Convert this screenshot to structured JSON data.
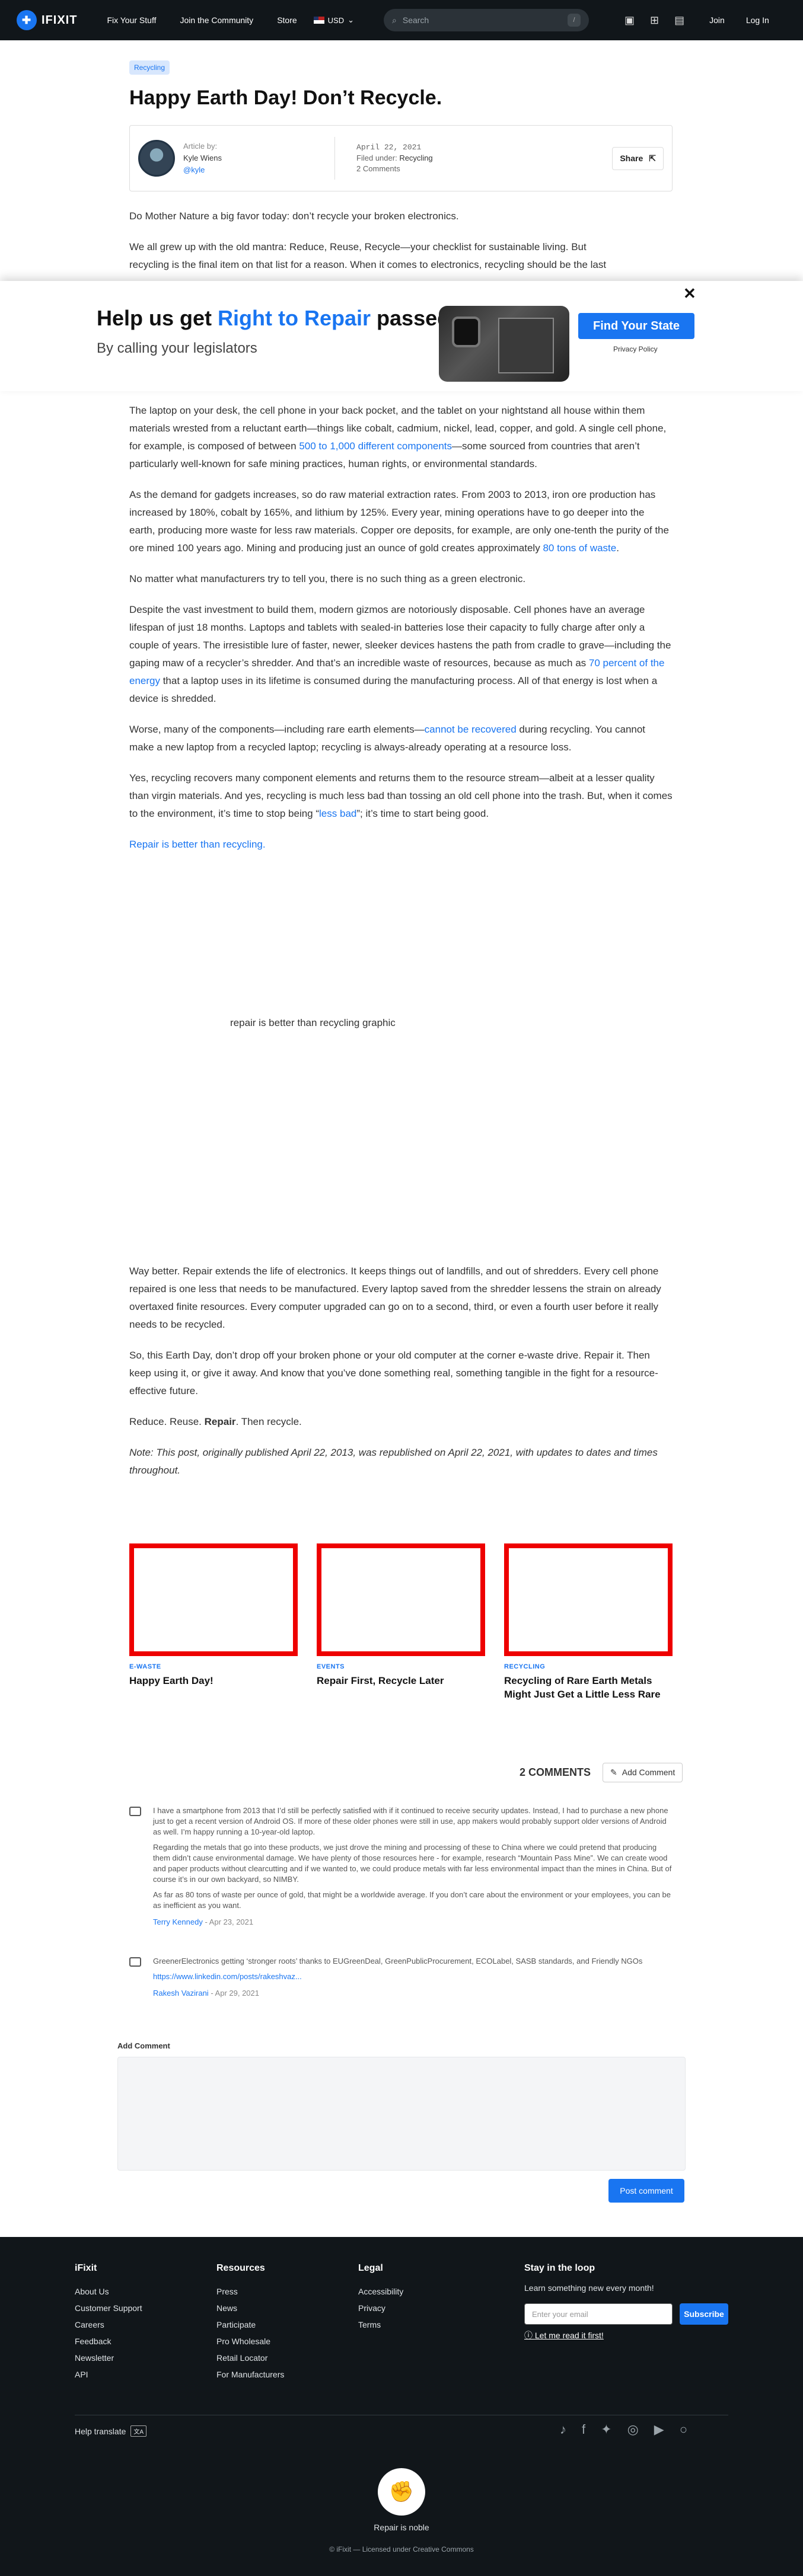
{
  "nav": {
    "logo": "IFIXIT",
    "links": [
      "Fix Your Stuff",
      "Join the Community",
      "Store"
    ],
    "currency": "USD",
    "search_placeholder": "Search",
    "join": "Join",
    "login": "Log In"
  },
  "article": {
    "tag": "Recycling",
    "title": "Happy Earth Day! Don’t Recycle.",
    "author_label": "Article by:",
    "author_name": "Kyle Wiens",
    "author_handle": "@kyle",
    "date": "April 22, 2021",
    "filed_label": "Filed under:",
    "filed_value": "Recycling",
    "comments": "2 Comments",
    "share": "Share",
    "intro_1": "Do Mother Nature a big favor today: don’t recycle your broken electronics.",
    "intro_2a": "We all grew up with the old mantra: Reduce, Reuse, Recycle—your checklist for sustainable living. But",
    "intro_2b": "recycling is the final item on that list for a reason. When it comes to electronics, recycling should be the last",
    "p3a": "The laptop on your desk, the cell phone in your back pocket, and the tablet on your nightstand all house within them materials wrested from a reluctant earth—things like cobalt, cadmium, nickel, lead, copper, and gold. A single cell phone, for example, is composed of between ",
    "p3link": "500 to 1,000 different components",
    "p3b": "—some sourced from countries that aren’t particularly well-known for safe mining practices, human rights, or environmental standards.",
    "p4a": "As the demand for gadgets increases, so do raw material extraction rates. From 2003 to 2013, iron ore production has increased by 180%, cobalt by 165%, and lithium by 125%. Every year, mining operations have to go deeper into the earth, producing more waste for less raw materials. Copper ore deposits, for example, are only one-tenth the purity of the ore mined 100 years ago. Mining and producing just an ounce of gold creates approximately ",
    "p4link": "80 tons of waste",
    "p4b": ".",
    "p5": "No matter what manufacturers try to tell you, there is no such thing as a green electronic.",
    "p6a": "Despite the vast investment to build them, modern gizmos are notoriously disposable. Cell phones have an average lifespan of just 18 months. Laptops and tablets with sealed-in batteries lose their capacity to fully charge after only a couple of years. The irresistible lure of faster, newer, sleeker devices hastens the path from cradle to grave—including the gaping maw of a recycler’s shredder. And that’s an incredible waste of resources, because as much as ",
    "p6link": "70 percent of the energy",
    "p6b": " that a laptop uses in its lifetime is consumed during the manufacturing process. All of that energy is lost when a device is shredded.",
    "p7a": "Worse, many of the components—including rare earth elements—",
    "p7link": "cannot be recovered",
    "p7b": " during recycling. You cannot make a new laptop from a recycled laptop; recycling is always-already operating at a resource loss.",
    "p8a": "Yes, recycling recovers many component elements and returns them to the resource stream—albeit at a lesser quality than virgin materials. And yes, recycling is much less bad than tossing an old cell phone into the trash. But, when it comes to the environment, it’s time to stop being “",
    "p8link": "less bad",
    "p8b": "”; it’s time to start being good.",
    "p9link": "Repair is better than recycling.",
    "graphic_alt": "repair is better than recycling graphic",
    "p10": "Way better. Repair extends the life of electronics. It keeps things out of landfills, and out of shredders. Every cell phone repaired is one less that needs to be manufactured. Every laptop saved from the shredder lessens the strain on already overtaxed finite resources. Every computer upgraded can go on to a second, third, or even a fourth user before it really needs to be recycled.",
    "p11": "So, this Earth Day, don’t drop off your broken phone or your old computer at the corner e-waste drive. Repair it. Then keep using it, or give it away. And know that you’ve done something real, something tangible in the fight for a resource-effective future.",
    "p12a": "Reduce. Reuse. ",
    "p12b": "Repair",
    "p12c": ". Then recycle.",
    "note": "Note: This post, originally published April 22, 2013, was republished on April 22, 2021, with updates to dates and times throughout."
  },
  "banner": {
    "title_a": "Help us get ",
    "title_b": "Right to Repair",
    "title_c": " passed",
    "subtitle": "By calling your legislators",
    "button": "Find Your State",
    "privacy": "Privacy Policy",
    "close": "✕"
  },
  "related": [
    {
      "category": "E-WASTE",
      "title": "Happy Earth Day!"
    },
    {
      "category": "EVENTS",
      "title": "Repair First, Recycle Later"
    },
    {
      "category": "RECYCLING",
      "title": "Recycling of Rare Earth Metals Might Just Get a Little Less Rare"
    }
  ],
  "comments": {
    "count": "2 COMMENTS",
    "add_button": "Add Comment",
    "items": [
      {
        "paragraphs": [
          "I have a smartphone from 2013 that I’d still be perfectly satisfied with if it continued to receive security updates. Instead, I had to purchase a new phone just to get a recent version of Android OS. If more of these older phones were still in use, app makers would probably support older versions of Android as well. I’m happy running a 10-year-old laptop.",
          "Regarding the metals that go into these products, we just drove the mining and processing of these to China where we could pretend that producing them didn’t cause environmental damage. We have plenty of those resources here - for example, research “Mountain Pass Mine”. We can create wood and paper products without clearcutting and if we wanted to, we could produce metals with far less environmental impact than the mines in China. But of course it’s in our own backyard, so NIMBY.",
          "As far as 80 tons of waste per ounce of gold, that might be a worldwide average. If you don’t care about the environment or your employees, you can be as inefficient as you want."
        ],
        "author": "Terry Kennedy",
        "date": " - Apr 23, 2021"
      },
      {
        "paragraphs": [
          "GreenerElectronics getting ‘stronger roots’ thanks to EUGreenDeal, GreenPublicProcurement, ECOLabel, SASB standards, and Friendly NGOs",
          "https://www.linkedin.com/posts/rakeshvaz..."
        ],
        "author": "Rakesh Vazirani",
        "date": " - Apr 29, 2021"
      }
    ],
    "add_label": "Add Comment",
    "post_button": "Post comment"
  },
  "footer": {
    "cols": [
      {
        "title": "iFixit",
        "items": [
          "About Us",
          "Customer Support",
          "Careers",
          "Feedback",
          "Newsletter",
          "API"
        ]
      },
      {
        "title": "Resources",
        "items": [
          "Press",
          "News",
          "Participate",
          "Pro Wholesale",
          "Retail Locator",
          "For Manufacturers"
        ]
      },
      {
        "title": "Legal",
        "items": [
          "Accessibility",
          "Privacy",
          "Terms"
        ]
      }
    ],
    "newsletter_title": "Stay in the loop",
    "newsletter_sub": "Learn something new every month!",
    "email_placeholder": "Enter your email",
    "subscribe": "Subscribe",
    "read_it": "Let me read it first!",
    "help_translate": "Help translate",
    "tagline": "Repair is noble",
    "license": "© iFixit — Licensed under Creative Commons"
  }
}
